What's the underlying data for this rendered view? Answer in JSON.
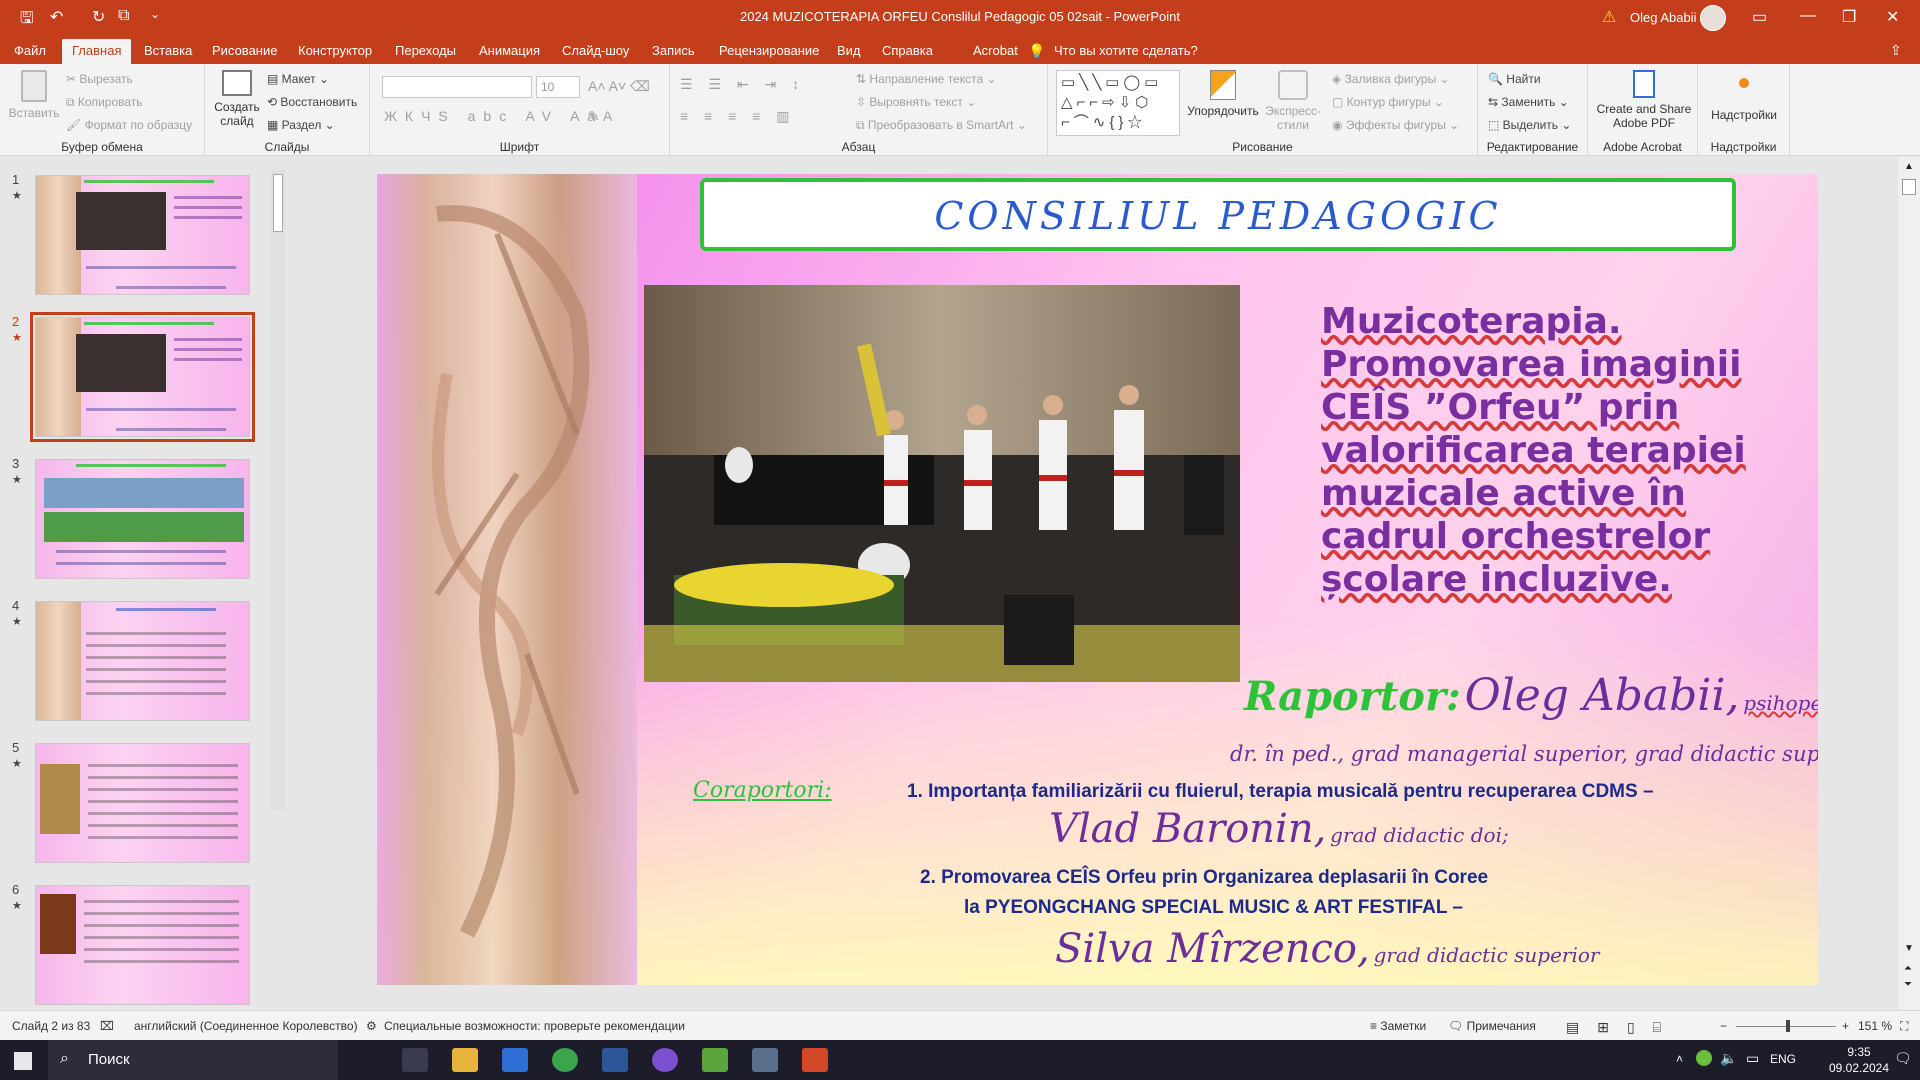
{
  "window": {
    "title": "2024 MUZICOTERAPIA ORFEU Conslilul Pedagogic 05 02sait  -  PowerPoint",
    "user": "Oleg Ababii"
  },
  "menu": {
    "items": [
      "Файл",
      "Главная",
      "Вставка",
      "Рисование",
      "Конструктор",
      "Переходы",
      "Анимация",
      "Слайд-шоу",
      "Запись",
      "Рецензирование",
      "Вид",
      "Справка",
      "Acrobat"
    ],
    "search_placeholder": "Что вы хотите сделать?"
  },
  "ribbon": {
    "clipboard": {
      "paste": "Вставить",
      "cut": "Вырезать",
      "copy": "Копировать",
      "format": "Формат по образцу",
      "label": "Буфер обмена"
    },
    "slides": {
      "new": "Создать слайд",
      "layout": "Макет",
      "reset": "Восстановить",
      "section": "Раздел",
      "label": "Слайды"
    },
    "font": {
      "size": "10",
      "label": "Шрифт"
    },
    "paragraph": {
      "direction": "Направление текста",
      "align": "Выровнять текст",
      "smartart": "Преобразовать в SmartArt",
      "label": "Абзац"
    },
    "drawing": {
      "arrange": "Упорядочить",
      "styles": "Экспресс-стили",
      "fill": "Заливка фигуры",
      "outline": "Контур фигуры",
      "effects": "Эффекты фигуры",
      "label": "Рисование"
    },
    "editing": {
      "find": "Найти",
      "replace": "Заменить",
      "select": "Выделить",
      "label": "Редактирование"
    },
    "acrobat": {
      "create": "Create and Share Adobe PDF",
      "label": "Adobe Acrobat"
    },
    "addins": {
      "btn": "Надстройки",
      "label": "Надстройки"
    }
  },
  "thumbnails": [
    {
      "num": "1",
      "star": "★"
    },
    {
      "num": "2",
      "star": "★"
    },
    {
      "num": "3",
      "star": "★"
    },
    {
      "num": "4",
      "star": "★"
    },
    {
      "num": "5",
      "star": "★"
    },
    {
      "num": "6",
      "star": "★"
    }
  ],
  "slide": {
    "title": "CONSILIUL    PEDAGOGIC",
    "subject_lines": [
      "Muzicoterapia.",
      "Promovarea imaginii",
      "CEÎS ”Orfeu”  prin",
      "valorificarea terapiei",
      "muzicale active în",
      "cadrul orchestrelor",
      "școlare incluzive."
    ],
    "raportor_label": "Raportor:",
    "raportor_name": "Oleg Ababii,",
    "raportor_role": "psihopedagog",
    "raportor_titles": "dr. în ped., grad managerial superior, grad didactic superior",
    "coraportori_label": "Coraportori:",
    "item1": "1.   Importanța familiarizării cu fluierul, terapia musicală pentru recuperarea CDMS –",
    "item1_name": "Vlad Baronin,",
    "item1_grade": "grad didactic doi;",
    "item2_line1": "2. Promovarea CEÎS Orfeu prin Organizarea deplasarii în Coree",
    "item2_line2": "la PYEONGCHANG SPECIAL MUSIC & ART FESTIFAL –",
    "item2_name": "Silva Mîrzenco,",
    "item2_grade": "grad didactic superior"
  },
  "status": {
    "slide": "Слайд 2 из 83",
    "lang": "английский (Соединенное Королевство)",
    "access": "Специальные возможности: проверьте рекомендации",
    "notes": "Заметки",
    "comments": "Примечания",
    "zoom": "151 %"
  },
  "taskbar": {
    "search": "Поиск",
    "lang": "ENG",
    "time": "9:35",
    "date": "09.02.2024"
  }
}
